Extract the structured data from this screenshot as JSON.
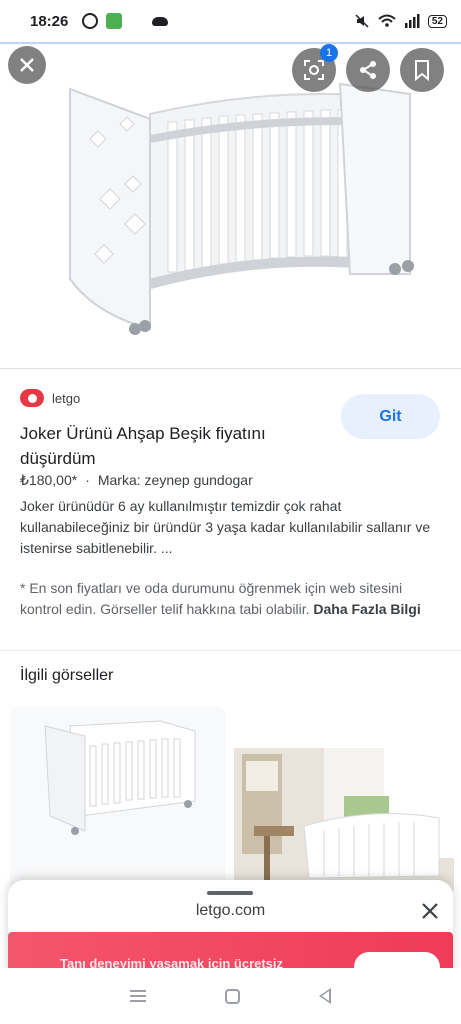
{
  "status_bar": {
    "time": "18:26",
    "battery": "52"
  },
  "result": {
    "source_name": "letgo",
    "visit_button": "Git",
    "title": "Joker Ürünü Ahşap Beşik fiyatını düşürdüm",
    "price": "₺180,00*",
    "brand": "Marka: zeynep gundogar",
    "description": "Joker ürünüdür 6 ay kullanılmıştır temizdir çok rahat kullanabileceğiniz bir üründür 3 yaşa kadar kullanılabilir sallanır ve istenirse sabitlenebilir. ...",
    "disclaimer": "* En son fiyatları ve oda durumunu öğrenmek için web sitesini kontrol edin. Görseller telif hakkına tabi olabilir.",
    "more_info": "Daha Fazla Bilgi"
  },
  "related": {
    "title": "İlgili görseller"
  },
  "overlay": {
    "lens_badge": "1"
  },
  "sheet": {
    "url": "letgo.com",
    "banner_text": "Tanı deneyimi yaşamak için ücretsiz"
  }
}
